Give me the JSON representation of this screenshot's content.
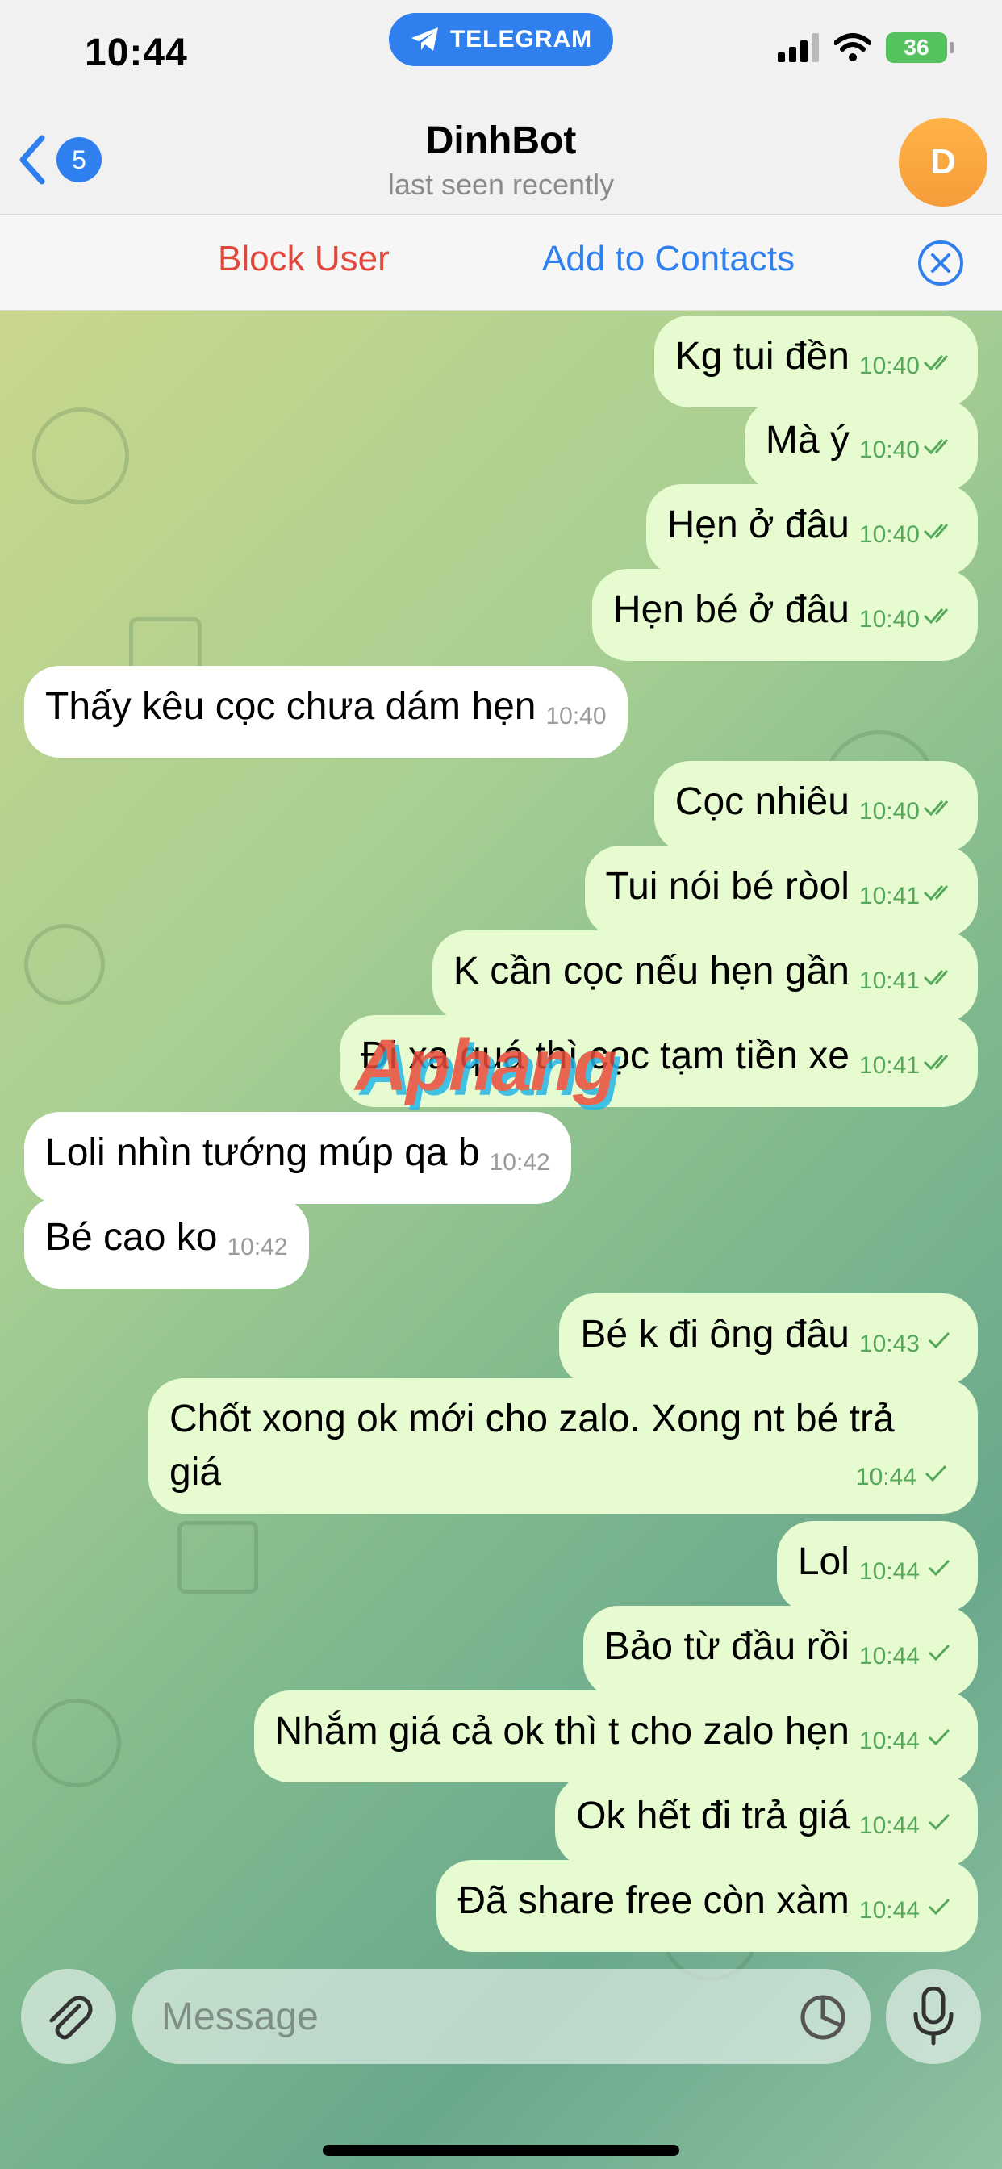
{
  "status_bar": {
    "time": "10:44",
    "app_pill": "TELEGRAM",
    "battery": "36"
  },
  "header": {
    "back_count": "5",
    "title": "DinhBot",
    "subtitle": "last seen recently",
    "avatar_letter": "D"
  },
  "actions": {
    "block_label": "Block User",
    "add_contacts_label": "Add to Contacts"
  },
  "messages": [
    {
      "text": "Kg tui đền",
      "time": "10:40",
      "dir": "out",
      "ticks": "double"
    },
    {
      "text": "Mà ý",
      "time": "10:40",
      "dir": "out",
      "ticks": "double"
    },
    {
      "text": "Hẹn ở đâu",
      "time": "10:40",
      "dir": "out",
      "ticks": "double"
    },
    {
      "text": "Hẹn bé ở đâu",
      "time": "10:40",
      "dir": "out",
      "ticks": "double"
    },
    {
      "text": "Thấy kêu cọc chưa dám hẹn",
      "time": "10:40",
      "dir": "in"
    },
    {
      "text": "Cọc nhiêu",
      "time": "10:40",
      "dir": "out",
      "ticks": "double"
    },
    {
      "text": "Tui nói bé ròol",
      "time": "10:41",
      "dir": "out",
      "ticks": "double"
    },
    {
      "text": "K cần cọc nếu hẹn gần",
      "time": "10:41",
      "dir": "out",
      "ticks": "double"
    },
    {
      "text": "Đi xa quá thì cọc tạm tiền xe",
      "time": "10:41",
      "dir": "out",
      "ticks": "double"
    },
    {
      "text": "Loli nhìn tướng múp qa b",
      "time": "10:42",
      "dir": "in"
    },
    {
      "text": "Bé cao ko",
      "time": "10:42",
      "dir": "in"
    },
    {
      "text": "Bé k đi ông đâu",
      "time": "10:43",
      "dir": "out",
      "ticks": "single"
    },
    {
      "text_line1": "Chốt xong ok mới cho zalo. Xong nt bé trả",
      "text_line2": "giá",
      "time": "10:44",
      "dir": "out",
      "ticks": "single"
    },
    {
      "text": "Lol",
      "time": "10:44",
      "dir": "out",
      "ticks": "single"
    },
    {
      "text": "Bảo từ đầu rồi",
      "time": "10:44",
      "dir": "out",
      "ticks": "single"
    },
    {
      "text": "Nhắm giá cả ok thì t cho zalo hẹn",
      "time": "10:44",
      "dir": "out",
      "ticks": "single"
    },
    {
      "text": "Ok hết đi trả giá",
      "time": "10:44",
      "dir": "out",
      "ticks": "single"
    },
    {
      "text": "Đã share free còn xàm",
      "time": "10:44",
      "dir": "out",
      "ticks": "single"
    }
  ],
  "watermark": "Aphang",
  "input": {
    "placeholder": "Message"
  },
  "colors": {
    "accent": "#2f80ee",
    "danger": "#e2473c",
    "outgoing_bubble": "#e7fbd0",
    "incoming_bubble": "#ffffff",
    "time_green": "#55a85a"
  },
  "icons": [
    "telegram-icon",
    "signal-icon",
    "wifi-icon",
    "battery-icon",
    "back-chevron-icon",
    "close-circle-icon",
    "paperclip-icon",
    "sticker-icon",
    "microphone-icon",
    "double-check-icon",
    "single-check-icon"
  ]
}
